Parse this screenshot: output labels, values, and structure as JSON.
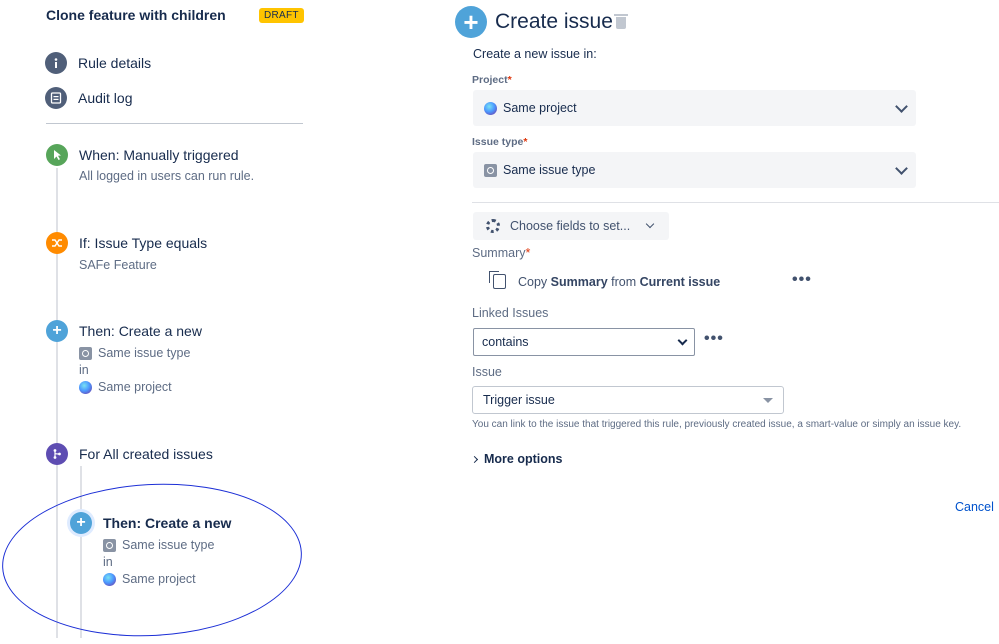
{
  "rule": {
    "title": "Clone feature with children",
    "status": "DRAFT"
  },
  "nav": [
    {
      "label": "Rule details",
      "icon": "info-icon"
    },
    {
      "label": "Audit log",
      "icon": "list-icon"
    }
  ],
  "steps": {
    "trigger": {
      "title": "When: Manually triggered",
      "sub": "All logged in users can run rule.",
      "color": "#57a55a"
    },
    "condition": {
      "title": "If: Issue Type equals",
      "sub": "SAFe Feature",
      "color": "#ff8b00"
    },
    "action1": {
      "title": "Then: Create a new",
      "issue_type": "Same issue type",
      "in": "in",
      "project": "Same project",
      "color": "#4fa3d9"
    },
    "branch": {
      "title": "For All created issues",
      "color": "#5e4db2"
    },
    "action2": {
      "title": "Then: Create a new",
      "issue_type": "Same issue type",
      "in": "in",
      "project": "Same project",
      "color": "#4fa3d9"
    }
  },
  "create_issue": {
    "title": "Create issue",
    "intro": "Create a new issue in:",
    "project_label": "Project",
    "project_value": "Same project",
    "issue_type_label": "Issue type",
    "issue_type_value": "Same issue type",
    "required_mark": "*",
    "choose_fields": "Choose fields to set...",
    "summary_label": "Summary",
    "summary": {
      "copy": "Copy",
      "field": "Summary",
      "from": "from",
      "source": "Current issue"
    },
    "more_dots": "•••",
    "linked_label": "Linked Issues",
    "linked_value": "contains",
    "issue_label": "Issue",
    "issue_value": "Trigger issue",
    "help_text": "You can link to the issue that triggered this rule, previously created issue, a smart-value or simply an issue key.",
    "more_options": "More options",
    "cancel": "Cancel"
  },
  "colors": {
    "accent": "#4fa3d9",
    "link": "#0052cc",
    "draft": "#ffc400",
    "annotation": "#1c2fd6"
  }
}
